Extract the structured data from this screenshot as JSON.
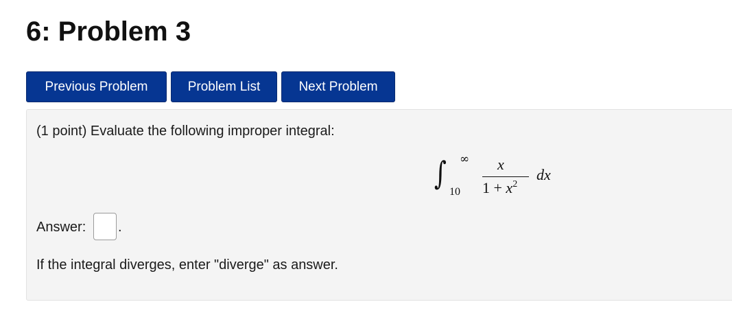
{
  "page": {
    "title": "6: Problem 3"
  },
  "nav": {
    "previous_label": "Previous Problem",
    "list_label": "Problem List",
    "next_label": "Next Problem"
  },
  "problem": {
    "statement": "(1 point) Evaluate the following improper integral:",
    "integral": {
      "sign": "∫",
      "upper_limit": "∞",
      "lower_limit": "10",
      "numerator": "x",
      "denominator_prefix": "1 + ",
      "denominator_var": "x",
      "denominator_exponent": "2",
      "differential": "dx"
    },
    "answer_label": "Answer:",
    "answer_value": "",
    "answer_suffix": ".",
    "hint": "If the integral diverges, enter \"diverge\" as answer."
  },
  "colors": {
    "button_background": "#063692",
    "button_text": "#ffffff",
    "panel_background": "#f4f4f4"
  }
}
